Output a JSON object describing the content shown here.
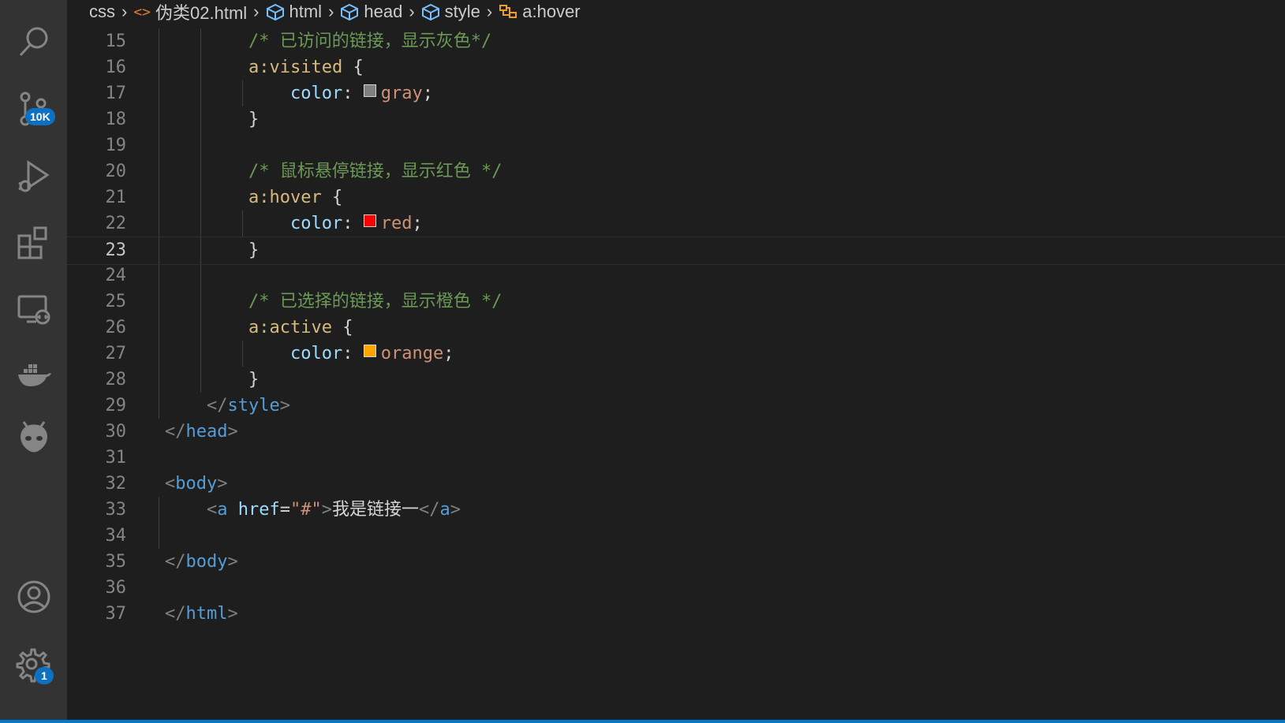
{
  "breadcrumb": {
    "items": [
      "css",
      "伪类02.html",
      "html",
      "head",
      "style",
      "a:hover"
    ]
  },
  "activity_bar": {
    "items": [
      {
        "name": "search-icon"
      },
      {
        "name": "source-control-icon",
        "badge": "10K"
      },
      {
        "name": "run-debug-icon"
      },
      {
        "name": "extensions-icon"
      },
      {
        "name": "remote-explorer-icon"
      },
      {
        "name": "docker-icon"
      },
      {
        "name": "alien-icon"
      },
      {
        "name": "account-icon"
      },
      {
        "name": "settings-gear-icon",
        "badge": "1"
      }
    ]
  },
  "editor": {
    "active_line": 23,
    "lines": [
      {
        "n": "15",
        "tokens": [
          [
            "comment",
            "/* 已访问的链接，显示灰色*/"
          ]
        ]
      },
      {
        "n": "16",
        "tokens": [
          [
            "selector",
            "a:visited"
          ],
          [
            "brace",
            " {"
          ]
        ]
      },
      {
        "n": "17",
        "tokens": [
          [
            "prop",
            "color"
          ],
          [
            "text",
            ": "
          ],
          [
            "swatch",
            "#808080"
          ],
          [
            "value",
            "gray"
          ],
          [
            "text",
            ";"
          ]
        ]
      },
      {
        "n": "18",
        "tokens": [
          [
            "brace",
            "}"
          ]
        ]
      },
      {
        "n": "19",
        "tokens": []
      },
      {
        "n": "20",
        "tokens": [
          [
            "comment",
            "/* 鼠标悬停链接，显示红色 */"
          ]
        ]
      },
      {
        "n": "21",
        "tokens": [
          [
            "selector",
            "a:hover"
          ],
          [
            "brace",
            " {"
          ]
        ]
      },
      {
        "n": "22",
        "tokens": [
          [
            "prop",
            "color"
          ],
          [
            "text",
            ": "
          ],
          [
            "swatch",
            "#ff0000"
          ],
          [
            "value",
            "red"
          ],
          [
            "text",
            ";"
          ]
        ]
      },
      {
        "n": "23",
        "tokens": [
          [
            "brace",
            "}"
          ]
        ]
      },
      {
        "n": "24",
        "tokens": []
      },
      {
        "n": "25",
        "tokens": [
          [
            "comment",
            "/* 已选择的链接，显示橙色 */"
          ]
        ]
      },
      {
        "n": "26",
        "tokens": [
          [
            "selector",
            "a:active"
          ],
          [
            "brace",
            " {"
          ]
        ]
      },
      {
        "n": "27",
        "tokens": [
          [
            "prop",
            "color"
          ],
          [
            "text",
            ": "
          ],
          [
            "swatch",
            "#ffa500"
          ],
          [
            "value",
            "orange"
          ],
          [
            "text",
            ";"
          ]
        ]
      },
      {
        "n": "28",
        "tokens": [
          [
            "brace",
            "}"
          ]
        ]
      },
      {
        "n": "29",
        "tokens": [
          [
            "punct",
            "</"
          ],
          [
            "tag",
            "style"
          ],
          [
            "punct",
            ">"
          ]
        ]
      },
      {
        "n": "30",
        "tokens": [
          [
            "punct",
            "</"
          ],
          [
            "tag",
            "head"
          ],
          [
            "punct",
            ">"
          ]
        ]
      },
      {
        "n": "31",
        "tokens": []
      },
      {
        "n": "32",
        "tokens": [
          [
            "punct",
            "<"
          ],
          [
            "tag",
            "body"
          ],
          [
            "punct",
            ">"
          ]
        ]
      },
      {
        "n": "33",
        "tokens": [
          [
            "punct",
            "<"
          ],
          [
            "tag",
            "a"
          ],
          [
            "text",
            " "
          ],
          [
            "attr",
            "href"
          ],
          [
            "text",
            "="
          ],
          [
            "str",
            "\"#\""
          ],
          [
            "punct",
            ">"
          ],
          [
            "text",
            "我是链接一"
          ],
          [
            "punct",
            "</"
          ],
          [
            "tag",
            "a"
          ],
          [
            "punct",
            ">"
          ]
        ]
      },
      {
        "n": "34",
        "tokens": []
      },
      {
        "n": "35",
        "tokens": [
          [
            "punct",
            "</"
          ],
          [
            "tag",
            "body"
          ],
          [
            "punct",
            ">"
          ]
        ]
      },
      {
        "n": "36",
        "tokens": []
      },
      {
        "n": "37",
        "tokens": [
          [
            "punct",
            "</"
          ],
          [
            "tag",
            "html"
          ],
          [
            "punct",
            ">"
          ]
        ]
      }
    ]
  },
  "colors": {
    "editor_bg": "#1e1e1e",
    "activity_bar_bg": "#333333",
    "badge_bg": "#0e70c0",
    "status_bar": "#007acc"
  }
}
